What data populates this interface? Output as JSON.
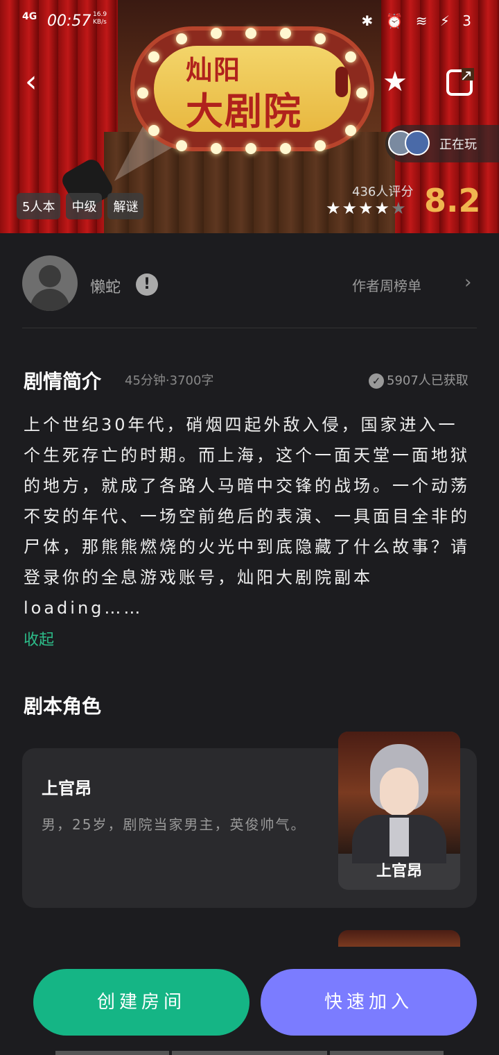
{
  "status_bar": {
    "network": "4G",
    "time": "00:57",
    "speed_value": "16.9",
    "speed_unit": "KB/s",
    "right_icons": "✱ ⏰ ≋ ⚡ 3"
  },
  "hero": {
    "sign_line1": "灿阳",
    "sign_line2": "大剧院",
    "playing_label": "正在玩",
    "tags": [
      "5人本",
      "中级",
      "解谜"
    ],
    "rating_count": "436人评分",
    "stars_full": "★★★★",
    "stars_empty": "★",
    "score": "8.2"
  },
  "author": {
    "name": "懒蛇",
    "rank_link": "作者周榜单"
  },
  "synopsis": {
    "title": "剧情简介",
    "meta": "45分钟·3700字",
    "acquired": "5907人已获取",
    "text": "上个世纪30年代，硝烟四起外敌入侵，国家进入一个生死存亡的时期。而上海，这个一面天堂一面地狱的地方，就成了各路人马暗中交锋的战场。一个动荡不安的年代、一场空前绝后的表演、一具面目全非的尸体，那熊熊燃烧的火光中到底隐藏了什么故事？请登录你的全息游戏账号，灿阳大剧院副本loading……",
    "collapse": "收起"
  },
  "roles": {
    "title": "剧本角色",
    "items": [
      {
        "name": "上官昂",
        "desc": "男，25岁，剧院当家男主，英俊帅气。",
        "portrait_label": "上官昂"
      }
    ]
  },
  "actions": {
    "create": "创建房间",
    "join": "快速加入"
  },
  "colors": {
    "create": "#15b585",
    "join": "#7b7cff",
    "score": "#f0b650",
    "collapse": "#2dbd8a"
  }
}
